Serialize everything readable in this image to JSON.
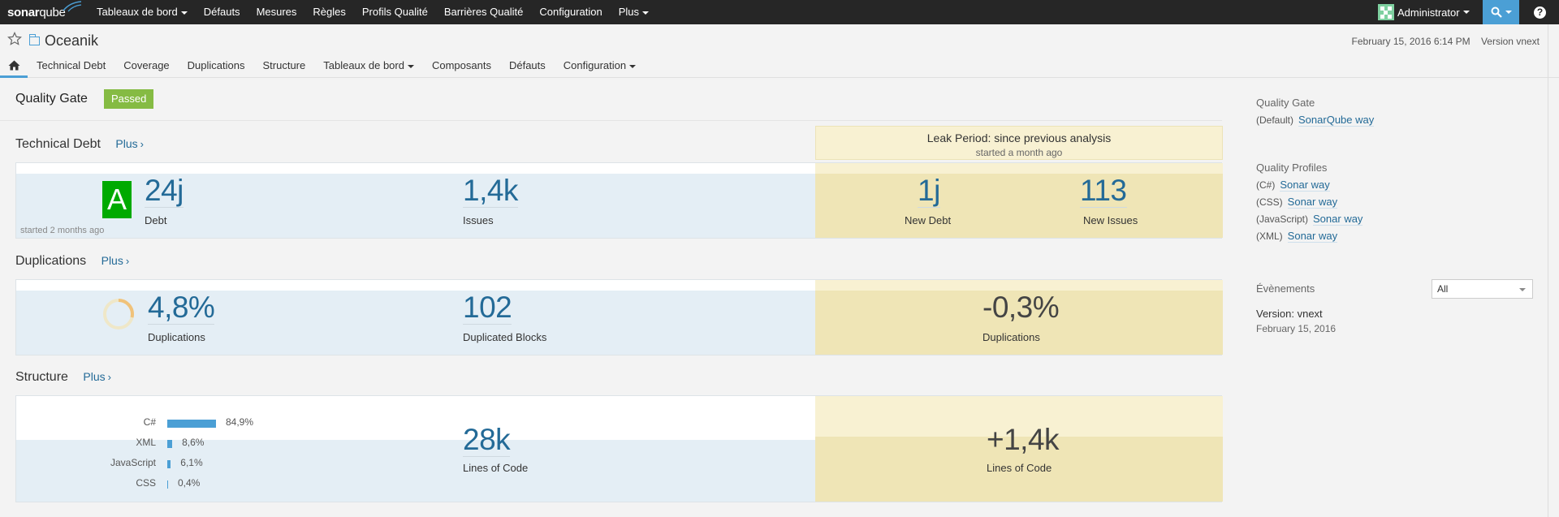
{
  "topbar": {
    "logo_part1": "sonar",
    "logo_part2": "qube",
    "nav": [
      "Tableaux de bord",
      "Défauts",
      "Mesures",
      "Règles",
      "Profils Qualité",
      "Barrières Qualité",
      "Configuration",
      "Plus"
    ],
    "nav_dropdown": [
      true,
      false,
      false,
      false,
      false,
      false,
      false,
      true
    ],
    "user": "Administrator"
  },
  "project": {
    "name": "Oceanik",
    "date": "February 15, 2016 6:14 PM",
    "version": "Version vnext",
    "tabs": [
      "Technical Debt",
      "Coverage",
      "Duplications",
      "Structure",
      "Tableaux de bord",
      "Composants",
      "Défauts",
      "Configuration"
    ],
    "tabs_dropdown": [
      false,
      false,
      false,
      false,
      true,
      false,
      false,
      true
    ]
  },
  "quality_gate": {
    "title": "Quality Gate",
    "status": "Passed",
    "status_color": "#85bb43"
  },
  "leak_period": {
    "title": "Leak Period: since previous analysis",
    "subtitle": "started a month ago"
  },
  "technical_debt": {
    "title": "Technical Debt",
    "more": "Plus",
    "rating": "A",
    "rating_color": "#00aa00",
    "debt_value": "24j",
    "debt_label": "Debt",
    "issues_value": "1,4k",
    "issues_label": "Issues",
    "started": "started 2 months ago",
    "new_debt_value": "1j",
    "new_debt_label": "New Debt",
    "new_issues_value": "113",
    "new_issues_label": "New Issues"
  },
  "duplications": {
    "title": "Duplications",
    "more": "Plus",
    "density_value": "4,8%",
    "density_fraction": 0.048,
    "density_label": "Duplications",
    "blocks_value": "102",
    "blocks_label": "Duplicated Blocks",
    "leak_value": "-0,3%",
    "leak_label": "Duplications"
  },
  "structure": {
    "title": "Structure",
    "more": "Plus",
    "languages": [
      {
        "name": "C#",
        "percent_text": "84,9%",
        "fraction": 0.849
      },
      {
        "name": "XML",
        "percent_text": "8,6%",
        "fraction": 0.086
      },
      {
        "name": "JavaScript",
        "percent_text": "6,1%",
        "fraction": 0.061
      },
      {
        "name": "CSS",
        "percent_text": "0,4%",
        "fraction": 0.004
      }
    ],
    "loc_value": "28k",
    "loc_label": "Lines of Code",
    "leak_value": "+1,4k",
    "leak_label": "Lines of Code"
  },
  "sidebar": {
    "quality_gate_title": "Quality Gate",
    "quality_gate_default": "(Default)",
    "quality_gate_link": "SonarQube way",
    "profiles_title": "Quality Profiles",
    "profiles": [
      {
        "lang": "(C#)",
        "name": "Sonar way"
      },
      {
        "lang": "(CSS)",
        "name": "Sonar way"
      },
      {
        "lang": "(JavaScript)",
        "name": "Sonar way"
      },
      {
        "lang": "(XML)",
        "name": "Sonar way"
      }
    ],
    "events_title": "Évènements",
    "events_filter": "All",
    "event_name": "Version: vnext",
    "event_date": "February 15, 2016"
  }
}
